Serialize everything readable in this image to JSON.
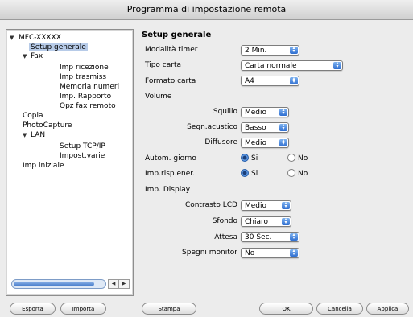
{
  "window": {
    "title": "Programma di impostazione remota"
  },
  "tree": {
    "items": [
      {
        "label": "MFC-XXXXX",
        "indent": 0,
        "arrow": true
      },
      {
        "label": "Setup generale",
        "indent": 1,
        "selected": true
      },
      {
        "label": "Fax",
        "indent": 1,
        "arrow": true
      },
      {
        "label": "Imp ricezione",
        "indent": 2
      },
      {
        "label": "Imp trasmiss",
        "indent": 2
      },
      {
        "label": "Memoria numeri",
        "indent": 2
      },
      {
        "label": "Imp. Rapporto",
        "indent": 2
      },
      {
        "label": "Opz fax remoto",
        "indent": 2
      },
      {
        "label": "Copia",
        "indent": 1
      },
      {
        "label": "PhotoCapture",
        "indent": 1
      },
      {
        "label": "LAN",
        "indent": 1,
        "arrow": true
      },
      {
        "label": "Setup TCP/IP",
        "indent": 2
      },
      {
        "label": "Impost.varie",
        "indent": 2
      },
      {
        "label": "Imp iniziale",
        "indent": 1
      }
    ]
  },
  "settings": {
    "section_title": "Setup generale",
    "modalita_timer": {
      "label": "Modalità timer",
      "value": "2 Min."
    },
    "tipo_carta": {
      "label": "Tipo carta",
      "value": "Carta normale"
    },
    "formato_carta": {
      "label": "Formato carta",
      "value": "A4"
    },
    "volume": {
      "label": "Volume"
    },
    "squillo": {
      "label": "Squillo",
      "value": "Medio"
    },
    "segn_acustico": {
      "label": "Segn.acustico",
      "value": "Basso"
    },
    "diffusore": {
      "label": "Diffusore",
      "value": "Medio"
    },
    "autom_giorno": {
      "label": "Autom. giorno",
      "yes": "Si",
      "no": "No",
      "selected": "Si"
    },
    "imp_risp_ener": {
      "label": "Imp.risp.ener.",
      "yes": "Si",
      "no": "No",
      "selected": "Si"
    },
    "imp_display": {
      "label": "Imp. Display"
    },
    "contrasto_lcd": {
      "label": "Contrasto LCD",
      "value": "Medio"
    },
    "sfondo": {
      "label": "Sfondo",
      "value": "Chiaro"
    },
    "attesa": {
      "label": "Attesa",
      "value": "30 Sec."
    },
    "spegni_monitor": {
      "label": "Spegni monitor",
      "value": "No"
    }
  },
  "buttons": {
    "esporta": "Esporta",
    "importa": "Importa",
    "stampa": "Stampa",
    "ok": "OK",
    "cancella": "Cancella",
    "applica": "Applica"
  },
  "icons": {
    "disclosure": "disclosure-triangle-icon",
    "popup": "popup-arrows-icon",
    "scroll_left": "scroll-left-icon",
    "scroll_right": "scroll-right-icon"
  }
}
